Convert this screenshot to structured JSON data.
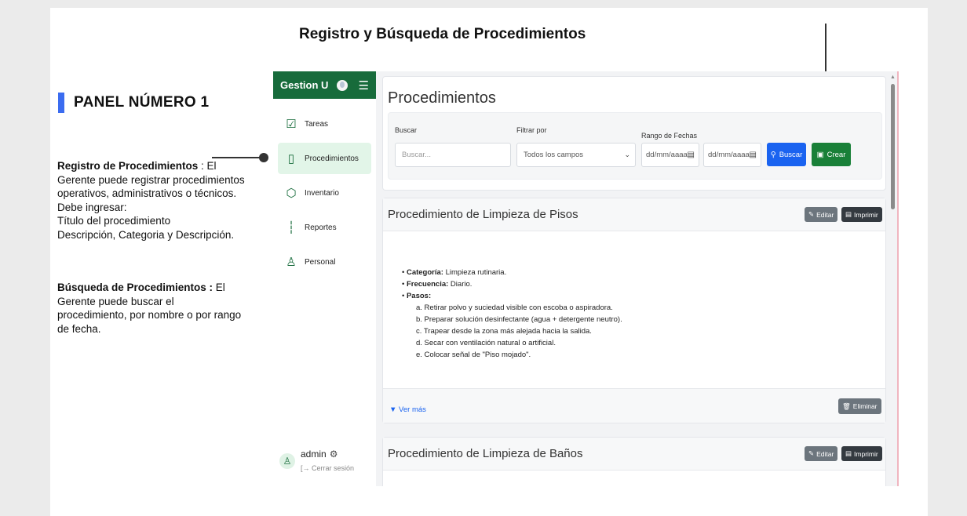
{
  "slide": {
    "title": "Registro  y Búsqueda de Procedimientos",
    "panel_heading": "PANEL NÚMERO 1",
    "registro": {
      "heading": "Registro de Procedimientos",
      "lines": [
        " : El",
        "Gerente puede registrar procedimientos",
        "operativos, administrativos o técnicos.",
        "Debe ingresar:",
        "Título del procedimiento",
        "Descripción, Categoria y Descripción."
      ]
    },
    "busqueda": {
      "heading": "Búsqueda de Procedimientos :",
      "lines": [
        " El",
        "Gerente puede  buscar el",
        "procedimiento, por nombre o por rango",
        "de fecha."
      ]
    }
  },
  "app": {
    "brand": "Gestion U",
    "nav": [
      {
        "label": "Tareas",
        "icon": "checkbox-icon"
      },
      {
        "label": "Procedimientos",
        "icon": "tablet-icon"
      },
      {
        "label": "Inventario",
        "icon": "box-icon"
      },
      {
        "label": "Reportes",
        "icon": "bar-chart-icon"
      },
      {
        "label": "Personal",
        "icon": "people-icon"
      }
    ],
    "user": {
      "name": "admin",
      "logout": "[→ Cerrar sesión"
    },
    "page_title": "Procedimientos",
    "filters": {
      "search_label": "Buscar",
      "search_placeholder": "Buscar...",
      "filter_label": "Filtrar por",
      "filter_value": "Todos los campos",
      "date_label": "Rango de Fechas",
      "date_from": "dd/mm/aaaa",
      "date_to": "dd/mm/aaaa",
      "search_button": "Buscar",
      "create_button": "Crear"
    },
    "procedures": [
      {
        "title": "Procedimiento de Limpieza de Pisos",
        "edit": "Editar",
        "print": "Imprimir",
        "categoria_label": "Categoría:",
        "categoria": " Limpieza rutinaria.",
        "frecuencia_label": "Frecuencia:",
        "frecuencia": " Diario.",
        "pasos_label": "Pasos:",
        "pasos": [
          "a. Retirar polvo y suciedad visible con escoba o aspiradora.",
          "b. Preparar solución desinfectante (agua + detergente neutro).",
          "c. Trapear desde la zona más alejada hacia la salida.",
          "d. Secar con ventilación natural o artificial.",
          "e. Colocar señal de \"Piso mojado\"."
        ],
        "ver_mas": "▼ Ver más",
        "delete": "Eliminar"
      },
      {
        "title": "Procedimiento de Limpieza de Baños",
        "edit": "Editar",
        "print": "Imprimir"
      }
    ]
  },
  "colors": {
    "brand_green": "#176b3b",
    "accent_blue": "#3b6cf0",
    "button_blue": "#1a63f0",
    "button_green": "#198038"
  }
}
